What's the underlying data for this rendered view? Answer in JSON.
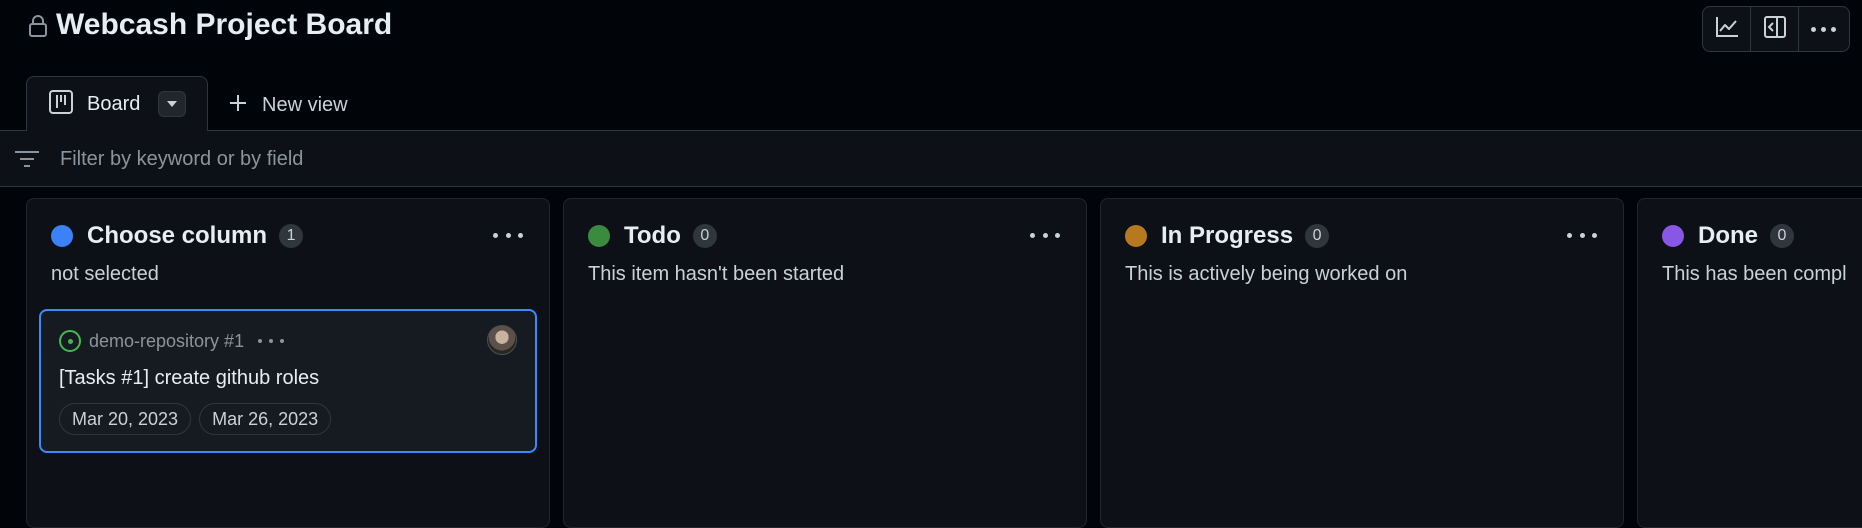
{
  "header": {
    "title": "Webcash Project Board",
    "lock_icon": "lock-icon",
    "toolbar": [
      "insights-chart-icon",
      "side-panel-icon",
      "kebab-menu-icon"
    ]
  },
  "views": {
    "tabs": [
      {
        "label": "Board",
        "icon": "project-board-icon",
        "selected": true
      }
    ],
    "new_view_label": "New view"
  },
  "filter": {
    "placeholder": "Filter by keyword or by field",
    "value": ""
  },
  "colors": {
    "choose_column": "#3b82f6",
    "todo": "#3a8a3f",
    "in_progress": "#b7791f",
    "done": "#8957e5",
    "accent": "#388bfd"
  },
  "columns": [
    {
      "name": "Choose column",
      "count": "1",
      "description": "not selected",
      "cards": [
        {
          "repo": "demo-repository #1",
          "title": "[Tasks #1] create github roles",
          "dates": [
            "Mar 20, 2023",
            "Mar 26, 2023"
          ],
          "status_icon": "issue-opened-icon"
        }
      ]
    },
    {
      "name": "Todo",
      "count": "0",
      "description": "This item hasn't been started",
      "cards": []
    },
    {
      "name": "In Progress",
      "count": "0",
      "description": "This is actively being worked on",
      "cards": []
    },
    {
      "name": "Done",
      "count": "0",
      "description": "This has been compl",
      "cards": []
    }
  ]
}
